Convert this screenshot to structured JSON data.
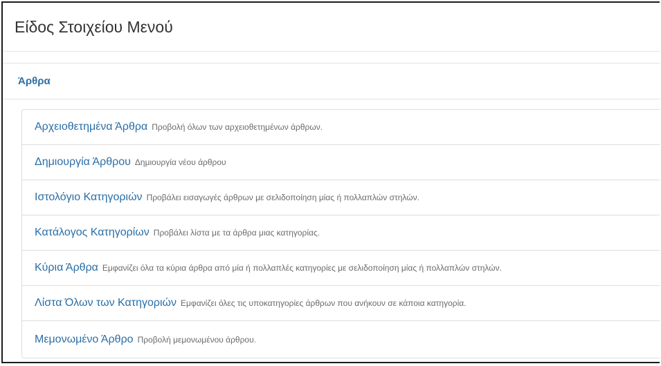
{
  "modal": {
    "title": "Είδος Στοιχείου Μενού"
  },
  "section": {
    "label": "Άρθρα"
  },
  "items": [
    {
      "title": "Αρχειοθετημένα Άρθρα",
      "description": "Προβολή όλων των αρχειοθετημένων άρθρων."
    },
    {
      "title": "Δημιουργία Άρθρου",
      "description": "Δημιουργία νέου άρθρου"
    },
    {
      "title": "Ιστολόγιο Κατηγοριών",
      "description": "Προβάλει εισαγωγές άρθρων με σελιδοποίηση μίας ή πολλαπλών στηλών."
    },
    {
      "title": "Κατάλογος Κατηγορίων",
      "description": "Προβάλει λίστα με τα άρθρα μιας κατηγορίας."
    },
    {
      "title": "Κύρια Άρθρα",
      "description": "Εμφανίζει όλα τα κύρια άρθρα από μία ή πολλαπλές κατηγορίες με σελιδοποίηση μίας ή πολλαπλών στηλών."
    },
    {
      "title": "Λίστα Όλων των Κατηγοριών",
      "description": "Εμφανίζει όλες τις υποκατηγορίες άρθρων που ανήκουν σε κάποια κατηγορία."
    },
    {
      "title": "Μεμονωμένο Άρθρο",
      "description": "Προβολή μεμονωμένου άρθρου."
    }
  ]
}
